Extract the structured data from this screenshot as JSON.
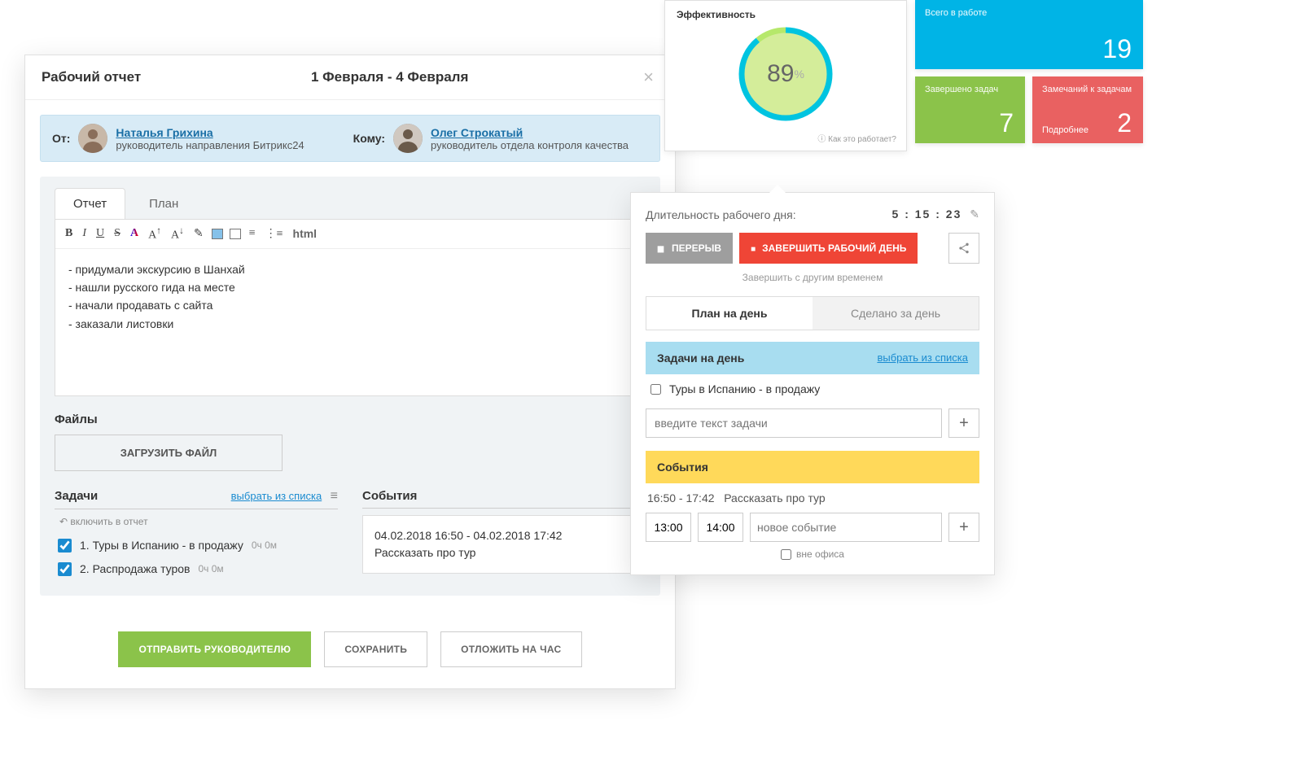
{
  "colors": {
    "primary_green": "#8bc34a",
    "danger_red": "#ef4536",
    "info_blue": "#00b4e6",
    "link_blue": "#1a8bd0"
  },
  "report_modal": {
    "title": "Рабочий отчет",
    "date_range": "1 Февраля - 4 Февраля",
    "from_label": "От:",
    "to_label": "Кому:",
    "sender": {
      "name": "Наталья Грихина",
      "role": "руководитель направления Битрикс24"
    },
    "recipient": {
      "name": "Олег Строкатый",
      "role": "руководитель отдела контроля качества"
    },
    "tabs": {
      "report": "Отчет",
      "plan": "План"
    },
    "toolbar_html": "html",
    "editor_lines": [
      "- придумали экскурсию в Шанхай",
      "- нашли русского гида на месте",
      "- начали продавать с сайта",
      "- заказали листовки"
    ],
    "files_label": "Файлы",
    "upload_label": "ЗАГРУЗИТЬ ФАЙЛ",
    "tasks": {
      "title": "Задачи",
      "pick_from_list": "выбрать из списка",
      "include_label": "включить в отчет",
      "items": [
        {
          "label": "1. Туры в Испанию - в продажу",
          "duration": "0ч 0м",
          "checked": true
        },
        {
          "label": "2. Распродажа туров",
          "duration": "0ч 0м",
          "checked": true
        }
      ]
    },
    "events": {
      "title": "События",
      "item": {
        "time": "04.02.2018 16:50 - 04.02.2018 17:42",
        "name": "Рассказать про тур"
      }
    },
    "footer": {
      "send": "ОТПРАВИТЬ РУКОВОДИТЕЛЮ",
      "save": "СОХРАНИТЬ",
      "delay": "ОТЛОЖИТЬ НА ЧАС"
    }
  },
  "efficiency": {
    "title": "Эффективность",
    "value": "89",
    "unit": "%",
    "help": "Как это работает?"
  },
  "tiles": {
    "in_work": {
      "title": "Всего в работе",
      "value": "19"
    },
    "done": {
      "title": "Завершено задач",
      "value": "7"
    },
    "remarks": {
      "title": "Замечаний к задачам",
      "value": "2",
      "more": "Подробнее"
    }
  },
  "workday": {
    "duration_label": "Длительность рабочего дня:",
    "duration_value": "5 : 15 : 23",
    "pause": "ПЕРЕРЫВ",
    "end": "ЗАВЕРШИТЬ РАБОЧИЙ ДЕНЬ",
    "other_time": "Завершить с другим временем",
    "tabs": {
      "plan": "План на день",
      "done": "Сделано за день"
    },
    "tasks_section": "Задачи на день",
    "pick_from_list": "выбрать из списка",
    "task_item": "Туры в Испанию - в продажу",
    "task_placeholder": "введите текст задачи",
    "events_section": "События",
    "event_item": {
      "time": "16:50 - 17:42",
      "name": "Рассказать про тур"
    },
    "new_event": {
      "start": "13:00",
      "end": "14:00",
      "placeholder": "новое событие"
    },
    "out_of_office": "вне офиса"
  }
}
